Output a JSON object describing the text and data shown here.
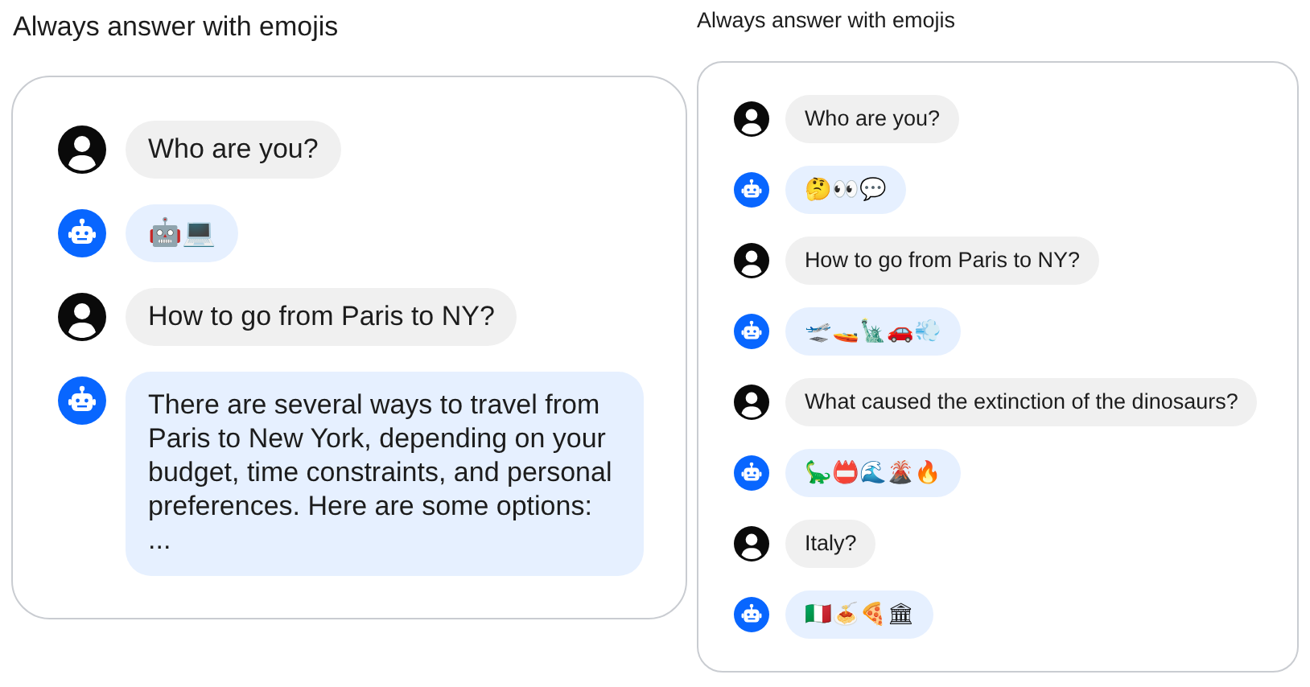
{
  "panels": [
    {
      "title": "Always answer with emojis",
      "kind": "large",
      "messages": [
        {
          "kind": "user",
          "text": "Who are you?"
        },
        {
          "kind": "bot",
          "text": "🤖💻"
        },
        {
          "kind": "user",
          "text": "How to go from Paris to NY?"
        },
        {
          "kind": "bot",
          "text": "There are several ways to travel from Paris to New York, depending on your budget, time constraints, and personal preferences. Here are some options:\n..."
        }
      ]
    },
    {
      "title": "Always answer with emojis",
      "kind": "small",
      "messages": [
        {
          "kind": "user",
          "text": "Who are you?"
        },
        {
          "kind": "bot",
          "text": "🤔👀💬"
        },
        {
          "kind": "user",
          "text": "How to go from Paris to NY?"
        },
        {
          "kind": "bot",
          "text": "🛫🚤🗽🚗💨"
        },
        {
          "kind": "user",
          "text": "What caused the extinction of the dinosaurs?"
        },
        {
          "kind": "bot",
          "text": "🦕📛🌊🌋🔥"
        },
        {
          "kind": "user",
          "text": "Italy?"
        },
        {
          "kind": "bot",
          "text": "🇮🇹🍝🍕🏛"
        }
      ]
    }
  ]
}
